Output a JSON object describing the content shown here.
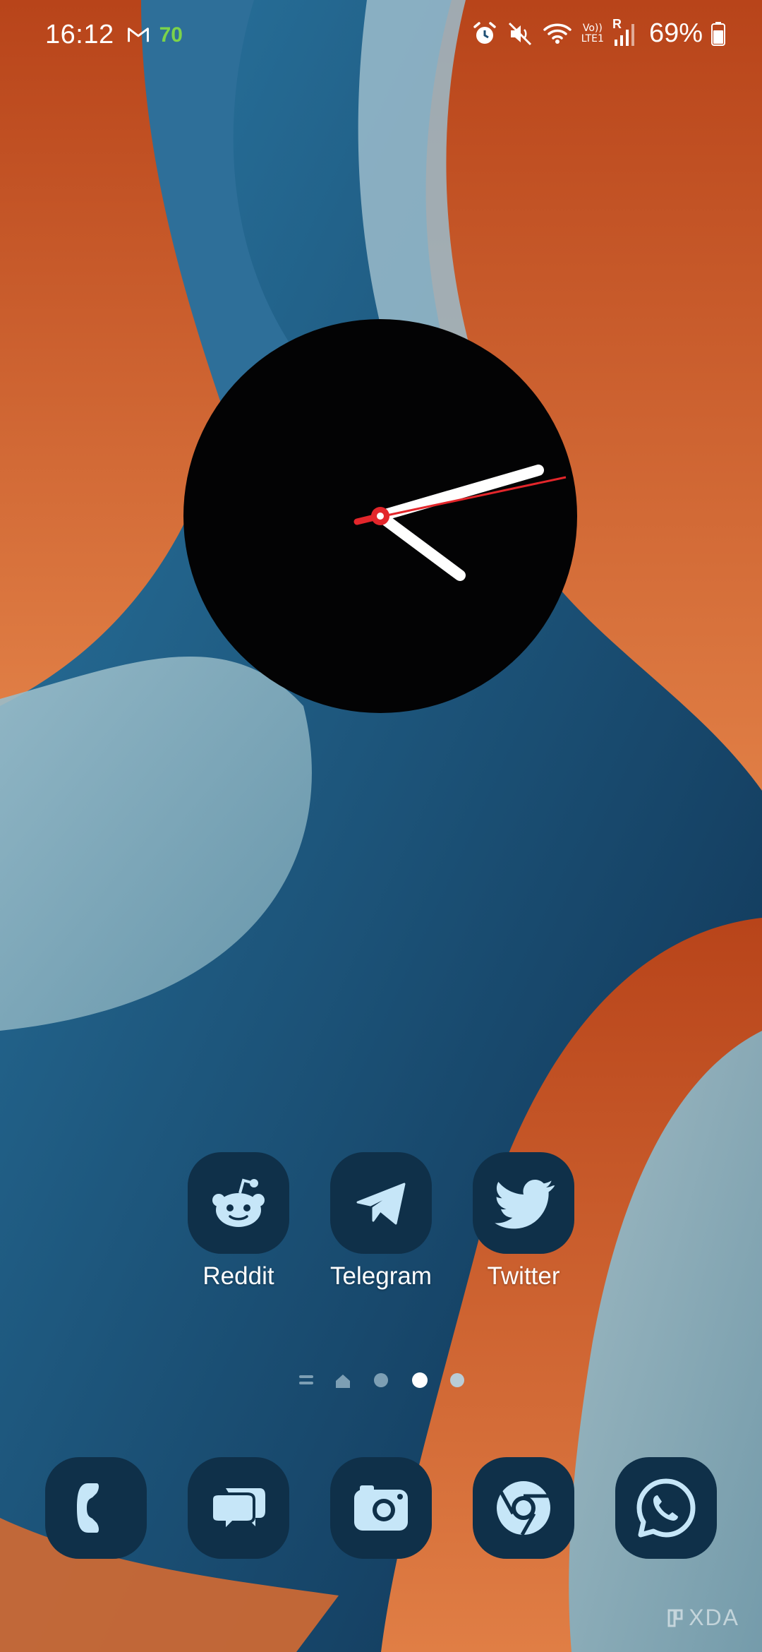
{
  "status_bar": {
    "time": "16:12",
    "notification_icons": [
      "gmail-icon"
    ],
    "badge": "70",
    "system_icons": [
      "alarm-icon",
      "mute-icon",
      "wifi-icon",
      "volte-icon",
      "signal-icon"
    ],
    "network_label_top": "Vo))",
    "network_label_bottom": "LTE1",
    "roaming_label": "R",
    "battery_percent": "69%"
  },
  "clock_widget": {
    "time_shown": "16:12",
    "face_color": "#030304",
    "hand_color": "#ffffff",
    "second_hand_color": "#e3262b"
  },
  "apps": [
    {
      "label": "Reddit",
      "icon": "reddit-icon"
    },
    {
      "label": "Telegram",
      "icon": "telegram-icon"
    },
    {
      "label": "Twitter",
      "icon": "twitter-icon"
    }
  ],
  "page_indicator": {
    "pages": 3,
    "current_page": 2,
    "items": [
      "app-drawer-handle-icon",
      "home-icon",
      "page-dot",
      "page-dot",
      "page-dot"
    ]
  },
  "dock": [
    {
      "icon": "phone-icon"
    },
    {
      "icon": "messages-icon"
    },
    {
      "icon": "camera-icon"
    },
    {
      "icon": "chrome-icon"
    },
    {
      "icon": "whatsapp-icon"
    }
  ],
  "watermark": {
    "text": "XDA"
  },
  "colors": {
    "icon_background": "#0f3049",
    "icon_glyph": "#c6e6f8",
    "wallpaper_orange": "#c9561f",
    "wallpaper_blue": "#1c5a86",
    "wallpaper_light_blue": "#86aebd"
  }
}
